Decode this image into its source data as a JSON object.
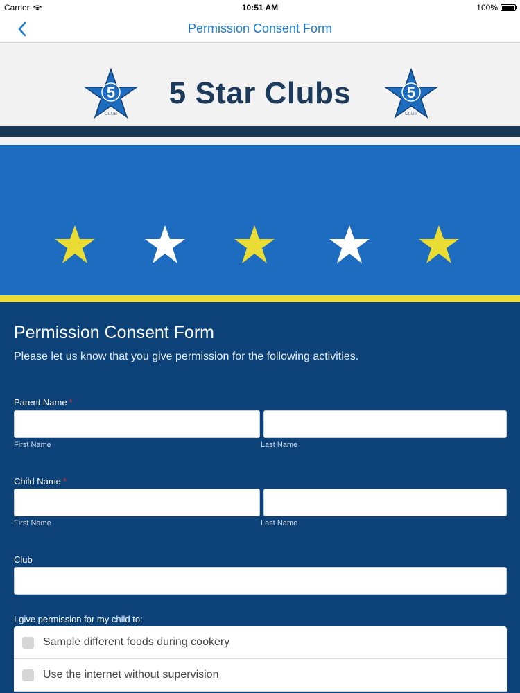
{
  "status_bar": {
    "carrier": "Carrier",
    "time": "10:51 AM",
    "battery": "100%"
  },
  "nav": {
    "title": "Permission Consent Form",
    "back_icon": "chevron-left-icon"
  },
  "banner": {
    "title": "5 Star Clubs",
    "logo_number": "5",
    "logo_caption": "CLUB"
  },
  "colors": {
    "accent_blue": "#1e6cc0",
    "navy": "#0d4279",
    "star_yellow": "#e8dc35",
    "required_red": "#d9383a"
  },
  "star_band": {
    "stars": [
      "yellow",
      "white",
      "yellow",
      "white",
      "yellow"
    ]
  },
  "form": {
    "title": "Permission Consent Form",
    "description": "Please let us know that you give permission for the following activities.",
    "required_marker": "*",
    "parent_name": {
      "label": "Parent Name",
      "first_label": "First Name",
      "last_label": "Last Name",
      "first_value": "",
      "last_value": ""
    },
    "child_name": {
      "label": "Child Name",
      "first_label": "First Name",
      "last_label": "Last Name",
      "first_value": "",
      "last_value": ""
    },
    "club": {
      "label": "Club",
      "value": ""
    },
    "permissions": {
      "label": "I give permission for my child to:",
      "items": [
        {
          "label": "Sample different foods during cookery",
          "checked": false
        },
        {
          "label": "Use the internet without supervision",
          "checked": false
        }
      ]
    }
  }
}
